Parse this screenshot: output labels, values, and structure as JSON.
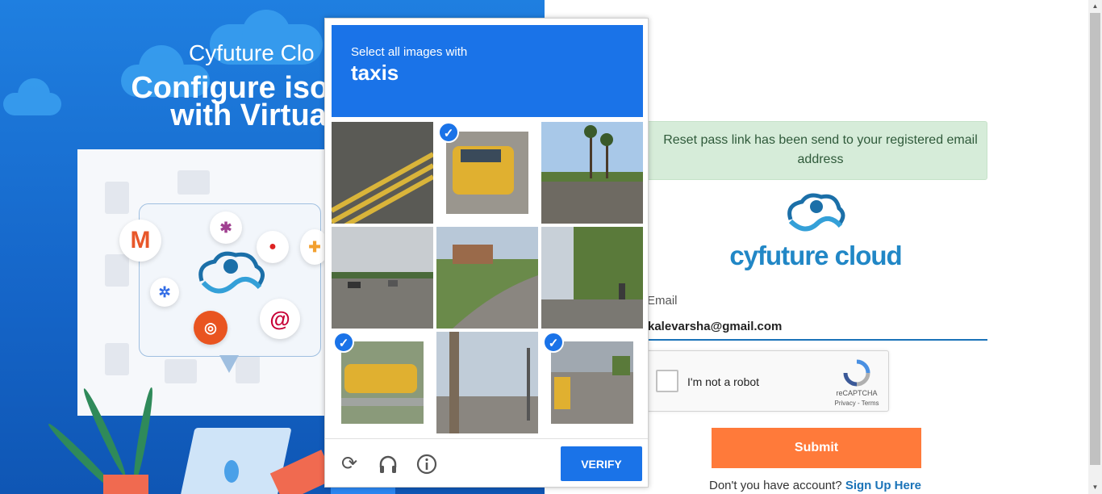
{
  "promo": {
    "subtitle": "Cyfuture Clo",
    "title_line1": "Configure isolated e",
    "title_line2": "with Virtual Ma"
  },
  "alert": {
    "message": "Reset pass link has been send to your registered email address"
  },
  "brand": {
    "name": "cyfuture cloud"
  },
  "form": {
    "email_label": "Email",
    "email_value": "kalevarsha@gmail.com",
    "recaptcha_label": "I'm not a robot",
    "recaptcha_brand": "reCAPTCHA",
    "recaptcha_links": "Privacy - Terms",
    "submit_label": "Submit",
    "signup_prompt": "Don't you have account?",
    "signup_link": "Sign Up Here"
  },
  "challenge": {
    "instruction": "Select all images with",
    "target": "taxis",
    "verify_label": "VERIFY",
    "tiles": [
      {
        "name": "road-markings",
        "selected": false
      },
      {
        "name": "yellow-taxi-rear",
        "selected": true
      },
      {
        "name": "palm-tree-street",
        "selected": false
      },
      {
        "name": "highway-cars",
        "selected": false
      },
      {
        "name": "curved-street-house",
        "selected": false
      },
      {
        "name": "street-with-trees",
        "selected": false
      },
      {
        "name": "yellow-taxi-side",
        "selected": true
      },
      {
        "name": "utility-pole",
        "selected": false
      },
      {
        "name": "taxi-row-street",
        "selected": true
      }
    ],
    "footer_icons": [
      "reload-icon",
      "audio-headphones-icon",
      "info-icon"
    ]
  },
  "colors": {
    "primary_blue": "#1a73e8",
    "submit_orange": "#ff7a3a",
    "alert_green": "#d6ecd9",
    "brand_blue": "#2187c6"
  }
}
